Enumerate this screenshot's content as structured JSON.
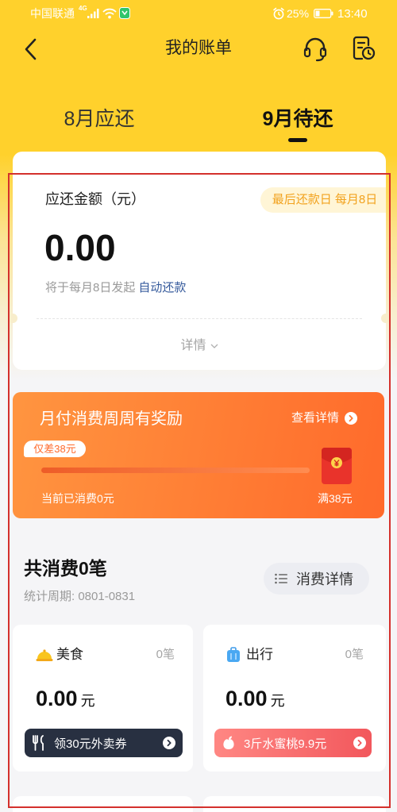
{
  "status_bar": {
    "carrier": "中国联通",
    "network": "4G",
    "battery": "25%",
    "time": "13:40",
    "icons": [
      "signal-icon",
      "wifi-icon",
      "app-notification-icon",
      "alarm-icon",
      "battery-icon"
    ]
  },
  "header": {
    "title": "我的账单",
    "icons": {
      "back": "back-arrow-icon",
      "service": "headset-icon",
      "history": "bill-history-icon"
    }
  },
  "tabs": [
    {
      "label": "8月应还",
      "active": false
    },
    {
      "label": "9月待还",
      "active": true
    }
  ],
  "summary": {
    "label": "应还金额（元）",
    "due_badge": "最后还款日 每月8日",
    "amount": "0.00",
    "note": "将于每月8日发起",
    "note_link": "自动还款",
    "details": "详情",
    "details_icon": "chevron-down-icon"
  },
  "promo": {
    "title": "月付消费周周有奖励",
    "link": "查看详情",
    "link_icon": "circle-arrow-right-icon",
    "gap_tag": "仅差38元",
    "progress": 0,
    "current": "当前已消费0元",
    "target": "满38元",
    "reward_icon": "red-envelope-icon"
  },
  "consumption": {
    "title": "共消费0笔",
    "period": "统计周期: 0801-0831",
    "details_button": "消费详情",
    "details_icon": "list-icon"
  },
  "categories": [
    {
      "name": "美食",
      "icon": "food-dish-icon",
      "count": "0笔",
      "amount": "0.00",
      "unit": "元",
      "cta": "领30元外卖券",
      "cta_icon": "fork-knife-icon"
    },
    {
      "name": "出行",
      "icon": "suitcase-icon",
      "count": "0笔",
      "amount": "0.00",
      "unit": "元",
      "cta": "3斤水蜜桃9.9元",
      "cta_icon": "peach-icon"
    }
  ],
  "colors": {
    "brand_yellow": "#FFD12C",
    "badge_bg": "#FFF5D6",
    "badge_text": "#F2A21E",
    "link_blue": "#34599B",
    "promo_start": "#FF9540",
    "promo_end": "#FF6A2B",
    "food_cta": "#283041",
    "travel_cta_start": "#FF8783",
    "travel_cta_end": "#F2575C",
    "highlight_frame": "#D4302C"
  }
}
